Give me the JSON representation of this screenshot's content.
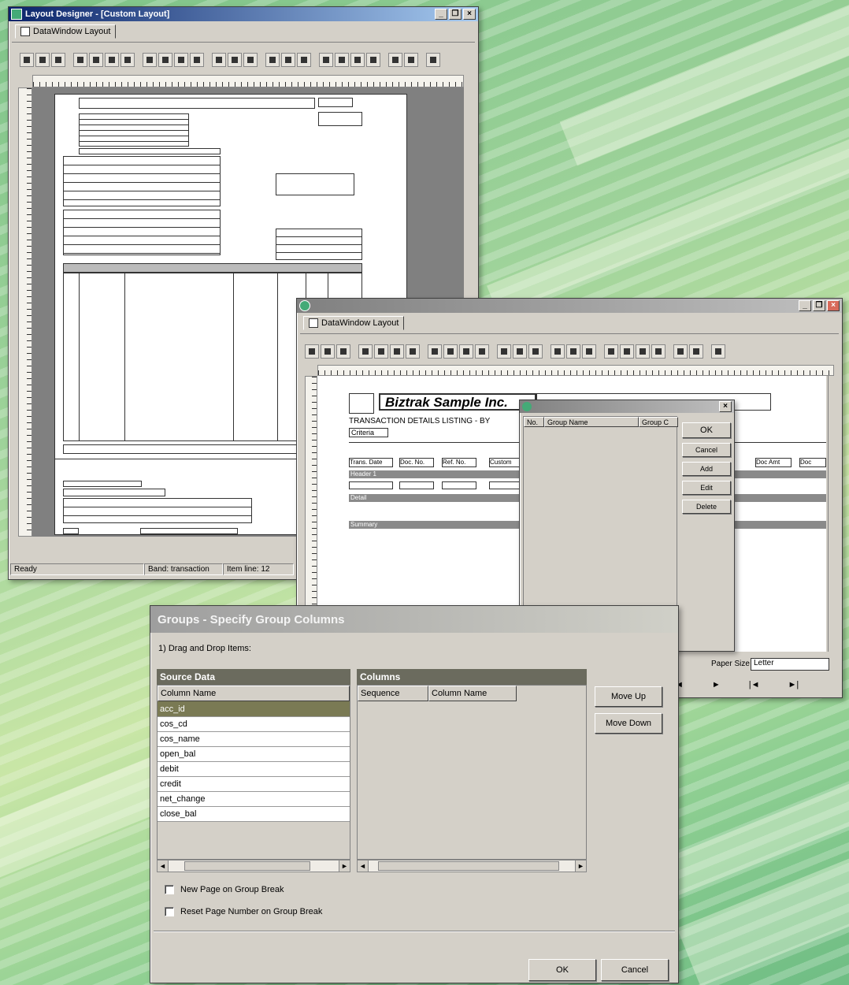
{
  "colors": {
    "accent_title": "#0a246a",
    "list_header_bg": "#6b6b5e",
    "selected_row_bg": "#7a7a54"
  },
  "window1": {
    "title": "Layout Designer - [Custom Layout]",
    "tab_label": "DataWindow Layout",
    "status_left": "Ready",
    "status_mid": "Band: transaction",
    "status_right": "Item line: 12"
  },
  "window2": {
    "tab_label": "DataWindow Layout",
    "report_title": "Biztrak Sample Inc.",
    "subtitle": "TRANSACTION DETAILS LISTING - BY",
    "criteria_label": "Criteria",
    "col_heads": [
      "Trans. Date",
      "Doc. No.",
      "Ref. No.",
      "Custom",
      "Doc Amt",
      "Doc"
    ],
    "band_header": "Header 1",
    "band_detail": "Detail",
    "band_summary": "Summary",
    "paper_size_label": "Paper Size",
    "paper_size_value": "Letter",
    "nav": [
      "◄",
      "►",
      "|◄",
      "►|"
    ]
  },
  "groups_popup": {
    "col_no": "No.",
    "col_group_name": "Group Name",
    "col_group_c": "Group C",
    "btn_ok": "OK",
    "btn_cancel": "Cancel",
    "btn_add": "Add",
    "btn_edit": "Edit",
    "btn_delete": "Delete"
  },
  "dialog": {
    "title": "Groups - Specify Group Columns",
    "instruction": "1) Drag and Drop Items:",
    "source_header": "Source Data",
    "source_col_header": "Column Name",
    "source_items": [
      "acc_id",
      "cos_cd",
      "cos_name",
      "open_bal",
      "debit",
      "credit",
      "net_change",
      "close_bal"
    ],
    "columns_header": "Columns",
    "columns_seq_header": "Sequence",
    "columns_name_header": "Column Name",
    "move_up": "Move Up",
    "move_down": "Move Down",
    "checkbox_new_page": "New Page on Group Break",
    "checkbox_reset_page": "Reset Page Number on Group Break",
    "ok": "OK",
    "cancel": "Cancel"
  }
}
